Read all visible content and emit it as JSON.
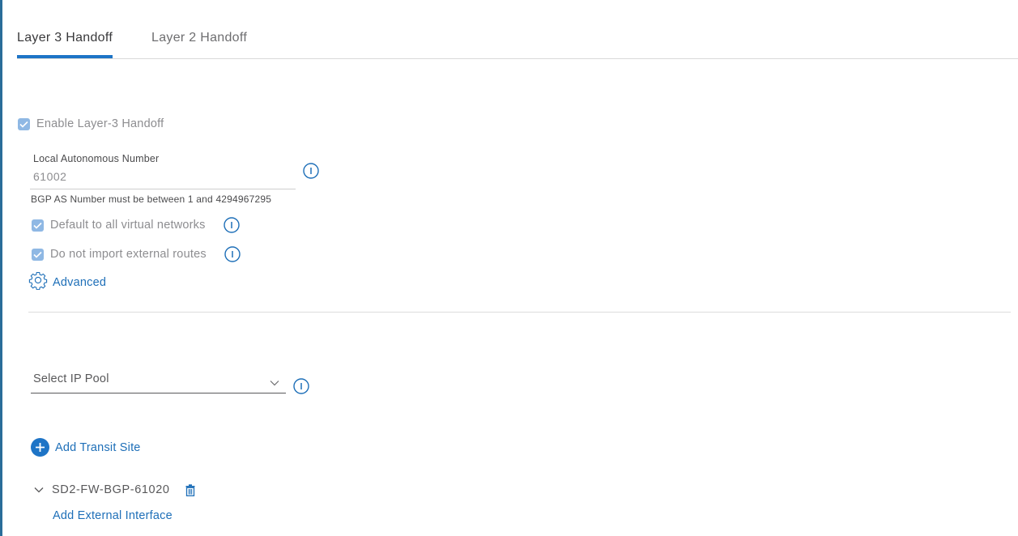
{
  "tabs": [
    {
      "label": "Layer 3 Handoff",
      "active": true
    },
    {
      "label": "Layer 2 Handoff",
      "active": false
    }
  ],
  "enable_handoff": {
    "label": "Enable Layer-3 Handoff",
    "checked": true
  },
  "local_as": {
    "label": "Local Autonomous Number",
    "value": "61002",
    "help": "BGP AS Number must be between 1 and 4294967295"
  },
  "options": [
    {
      "label": "Default to all virtual networks",
      "checked": true
    },
    {
      "label": "Do not import external routes",
      "checked": true
    }
  ],
  "advanced": {
    "label": "Advanced"
  },
  "ip_pool": {
    "placeholder": "Select IP Pool"
  },
  "add_transit": {
    "label": "Add Transit Site"
  },
  "transit_sites": [
    {
      "name": "SD2-FW-BGP-61020",
      "add_interface_label": "Add External Interface"
    }
  ],
  "colors": {
    "accent": "#1e74c6",
    "link": "#1e6fb8",
    "checkbox_disabled": "#8fb8e4",
    "left_border": "#2a6d99"
  }
}
